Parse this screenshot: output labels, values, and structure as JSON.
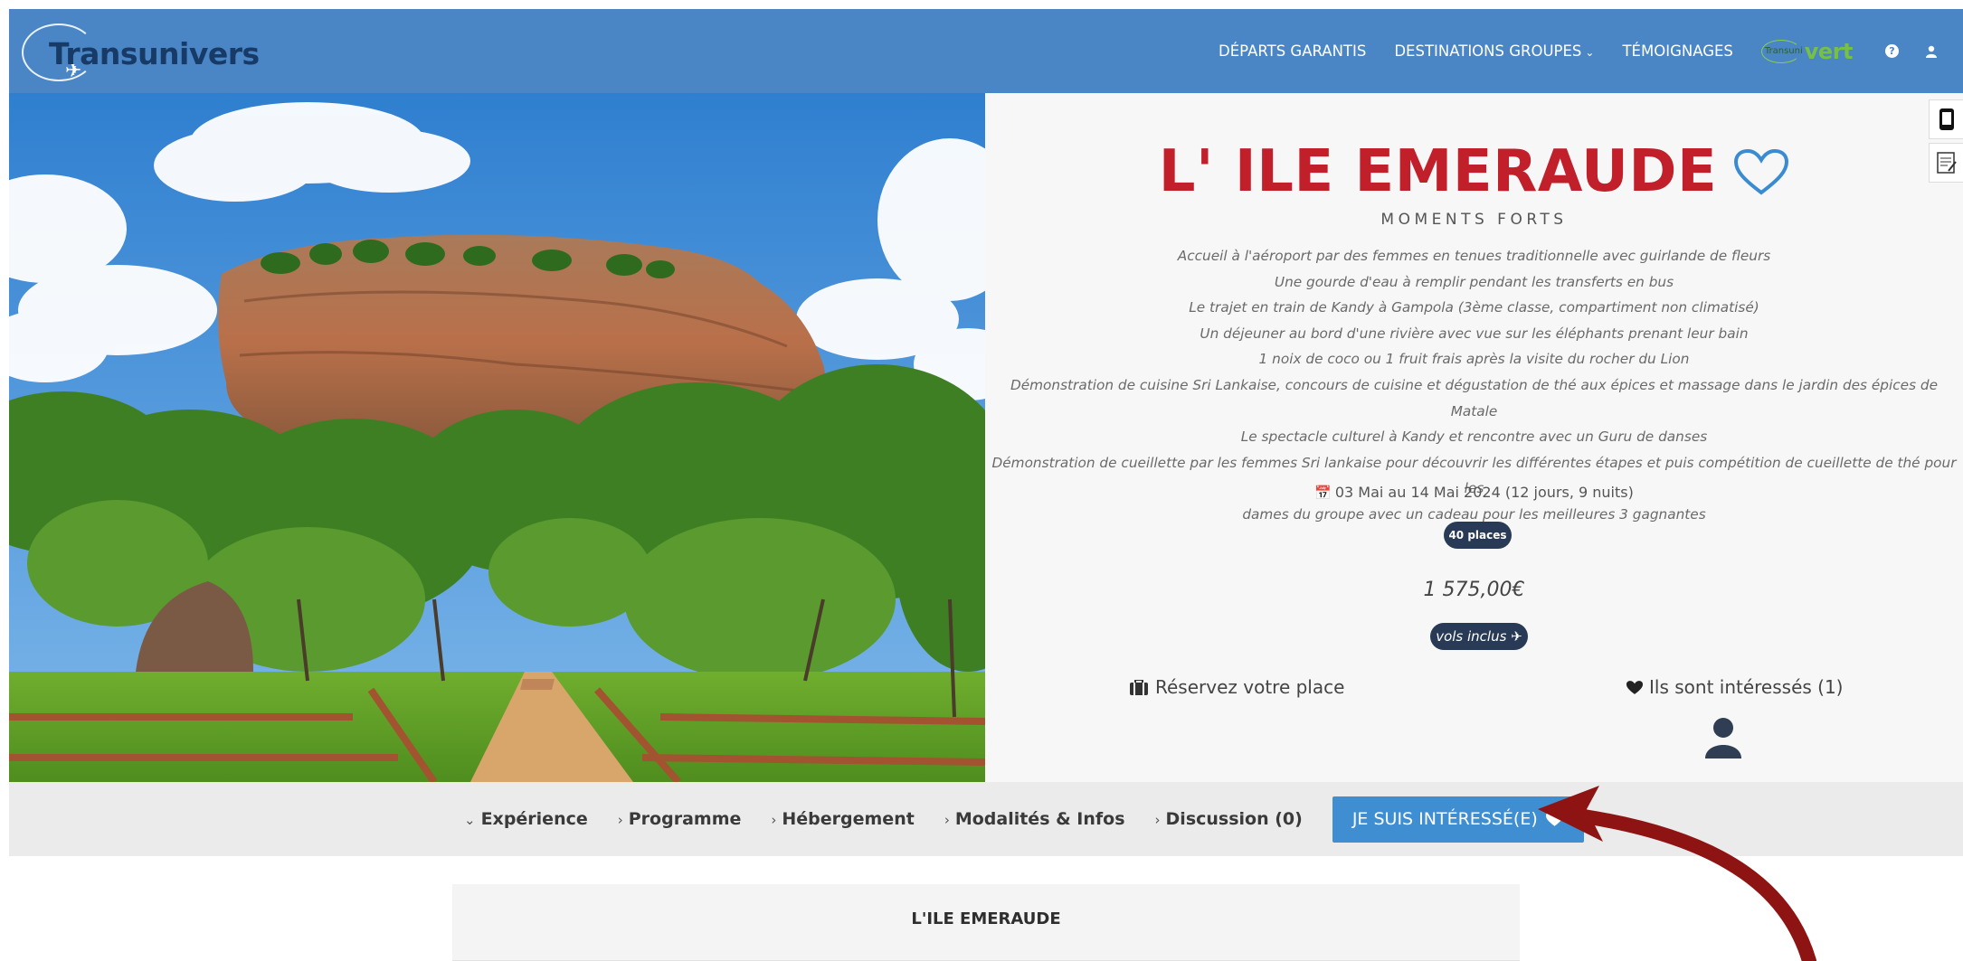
{
  "header": {
    "logo_text": "Transunivers",
    "nav": {
      "departs": "DÉPARTS GARANTIS",
      "destinations": "DESTINATIONS GROUPES",
      "temoignages": "TÉMOIGNAGES"
    },
    "vert_logo_small": "Transuni",
    "vert_logo_big": "vert"
  },
  "hero": {
    "title": "L' ILE EMERAUDE",
    "moments_title": "MOMENTS FORTS",
    "moments": [
      "Accueil à l'aéroport par des femmes en tenues traditionnelle avec guirlande de fleurs",
      "Une gourde d'eau à remplir pendant les transferts en bus",
      "Le trajet en train de Kandy à Gampola (3ème classe, compartiment non climatisé)",
      "Un déjeuner au bord d'une rivière avec vue sur les éléphants prenant leur bain",
      "1 noix de coco ou 1 fruit frais après la visite du rocher du Lion",
      "Démonstration de cuisine Sri Lankaise, concours de cuisine et dégustation de thé aux épices et massage dans le jardin des épices de Matale",
      "Le spectacle culturel à Kandy et rencontre avec un Guru de danses",
      "Démonstration de cueillette par les femmes Sri lankaise pour découvrir les différentes étapes et puis compétition de cueillette de thé pour les",
      "dames du groupe avec un cadeau pour les meilleures 3 gagnantes"
    ],
    "dates": "03 Mai au 14 Mai 2024 (12 jours, 9 nuits)",
    "places": "40 places",
    "price": "1 575,00€",
    "flights": "vols inclus",
    "reserve_label": "Réservez votre place",
    "interested_label": "Ils sont intéressés (1)"
  },
  "tabs": {
    "experience": "Expérience",
    "programme": "Programme",
    "hebergement": "Hébergement",
    "modalites": "Modalités & Infos",
    "discussion": "Discussion (0)",
    "interest_button": "JE SUIS INTÉRESSÉ(E)"
  },
  "content": {
    "section_title": "L'ILE EMERAUDE"
  },
  "colors": {
    "header_bg": "#4a86c6",
    "title_red": "#c11f2a",
    "badge_navy": "#283a55",
    "button_blue": "#3f8ed1",
    "arrow_red": "#8e1414"
  }
}
